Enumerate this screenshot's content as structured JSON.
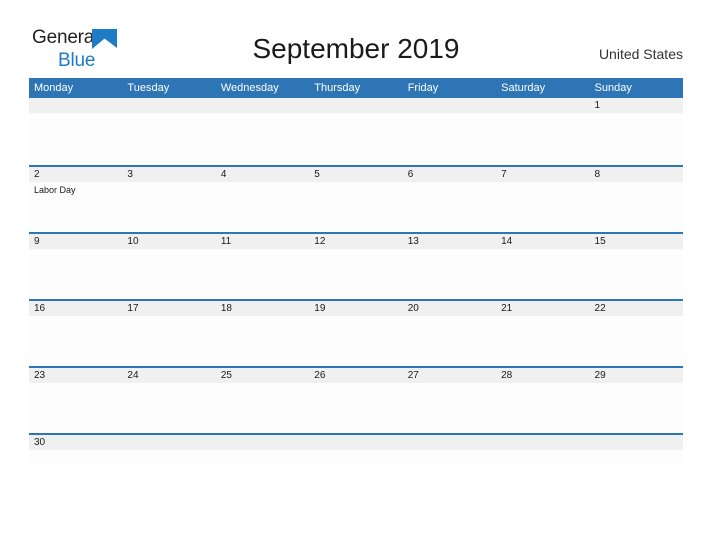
{
  "brand": {
    "line1": "General",
    "line2": "Blue",
    "mark_icon": "blue-triangle-flag-icon",
    "accent_color": "#1d7cc4"
  },
  "header": {
    "title": "September 2019",
    "country": "United States"
  },
  "theme": {
    "header_blue": "#2e75b6",
    "row_gray": "#f0f0f0",
    "text": "#1a1a1a"
  },
  "calendar": {
    "weekday_headers": [
      "Monday",
      "Tuesday",
      "Wednesday",
      "Thursday",
      "Friday",
      "Saturday",
      "Sunday"
    ],
    "weeks": [
      {
        "days": [
          {
            "number": "",
            "event": ""
          },
          {
            "number": "",
            "event": ""
          },
          {
            "number": "",
            "event": ""
          },
          {
            "number": "",
            "event": ""
          },
          {
            "number": "",
            "event": ""
          },
          {
            "number": "",
            "event": ""
          },
          {
            "number": "1",
            "event": ""
          }
        ]
      },
      {
        "days": [
          {
            "number": "2",
            "event": "Labor Day"
          },
          {
            "number": "3",
            "event": ""
          },
          {
            "number": "4",
            "event": ""
          },
          {
            "number": "5",
            "event": ""
          },
          {
            "number": "6",
            "event": ""
          },
          {
            "number": "7",
            "event": ""
          },
          {
            "number": "8",
            "event": ""
          }
        ]
      },
      {
        "days": [
          {
            "number": "9",
            "event": ""
          },
          {
            "number": "10",
            "event": ""
          },
          {
            "number": "11",
            "event": ""
          },
          {
            "number": "12",
            "event": ""
          },
          {
            "number": "13",
            "event": ""
          },
          {
            "number": "14",
            "event": ""
          },
          {
            "number": "15",
            "event": ""
          }
        ]
      },
      {
        "days": [
          {
            "number": "16",
            "event": ""
          },
          {
            "number": "17",
            "event": ""
          },
          {
            "number": "18",
            "event": ""
          },
          {
            "number": "19",
            "event": ""
          },
          {
            "number": "20",
            "event": ""
          },
          {
            "number": "21",
            "event": ""
          },
          {
            "number": "22",
            "event": ""
          }
        ]
      },
      {
        "days": [
          {
            "number": "23",
            "event": ""
          },
          {
            "number": "24",
            "event": ""
          },
          {
            "number": "25",
            "event": ""
          },
          {
            "number": "26",
            "event": ""
          },
          {
            "number": "27",
            "event": ""
          },
          {
            "number": "28",
            "event": ""
          },
          {
            "number": "29",
            "event": ""
          }
        ]
      },
      {
        "days": [
          {
            "number": "30",
            "event": ""
          },
          {
            "number": "",
            "event": ""
          },
          {
            "number": "",
            "event": ""
          },
          {
            "number": "",
            "event": ""
          },
          {
            "number": "",
            "event": ""
          },
          {
            "number": "",
            "event": ""
          },
          {
            "number": "",
            "event": ""
          }
        ]
      }
    ]
  }
}
